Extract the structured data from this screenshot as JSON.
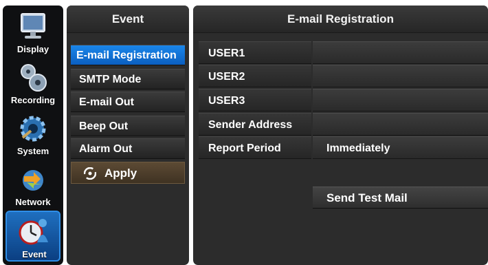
{
  "sidebar": {
    "items": [
      {
        "label": "Display",
        "icon": "monitor-icon"
      },
      {
        "label": "Recording",
        "icon": "film-reels-icon"
      },
      {
        "label": "System",
        "icon": "gear-icon"
      },
      {
        "label": "Network",
        "icon": "network-arrows-icon"
      },
      {
        "label": "Event",
        "icon": "clock-person-icon"
      }
    ],
    "active": "Event"
  },
  "event_menu": {
    "title": "Event",
    "items": [
      "E-mail Registration",
      "SMTP Mode",
      "E-mail Out",
      "Beep Out",
      "Alarm Out"
    ],
    "selected": "E-mail Registration",
    "apply_label": "Apply"
  },
  "email_registration": {
    "title": "E-mail Registration",
    "rows": [
      {
        "label": "USER1",
        "value": ""
      },
      {
        "label": "USER2",
        "value": ""
      },
      {
        "label": "USER3",
        "value": ""
      },
      {
        "label": "Sender Address",
        "value": ""
      },
      {
        "label": "Report Period",
        "value": "Immediately"
      }
    ],
    "send_test_label": "Send Test Mail"
  },
  "colors": {
    "accent": "#1a86ea",
    "panel_bg": "#2c2c2c",
    "apply_bg": "#5c4a34"
  }
}
